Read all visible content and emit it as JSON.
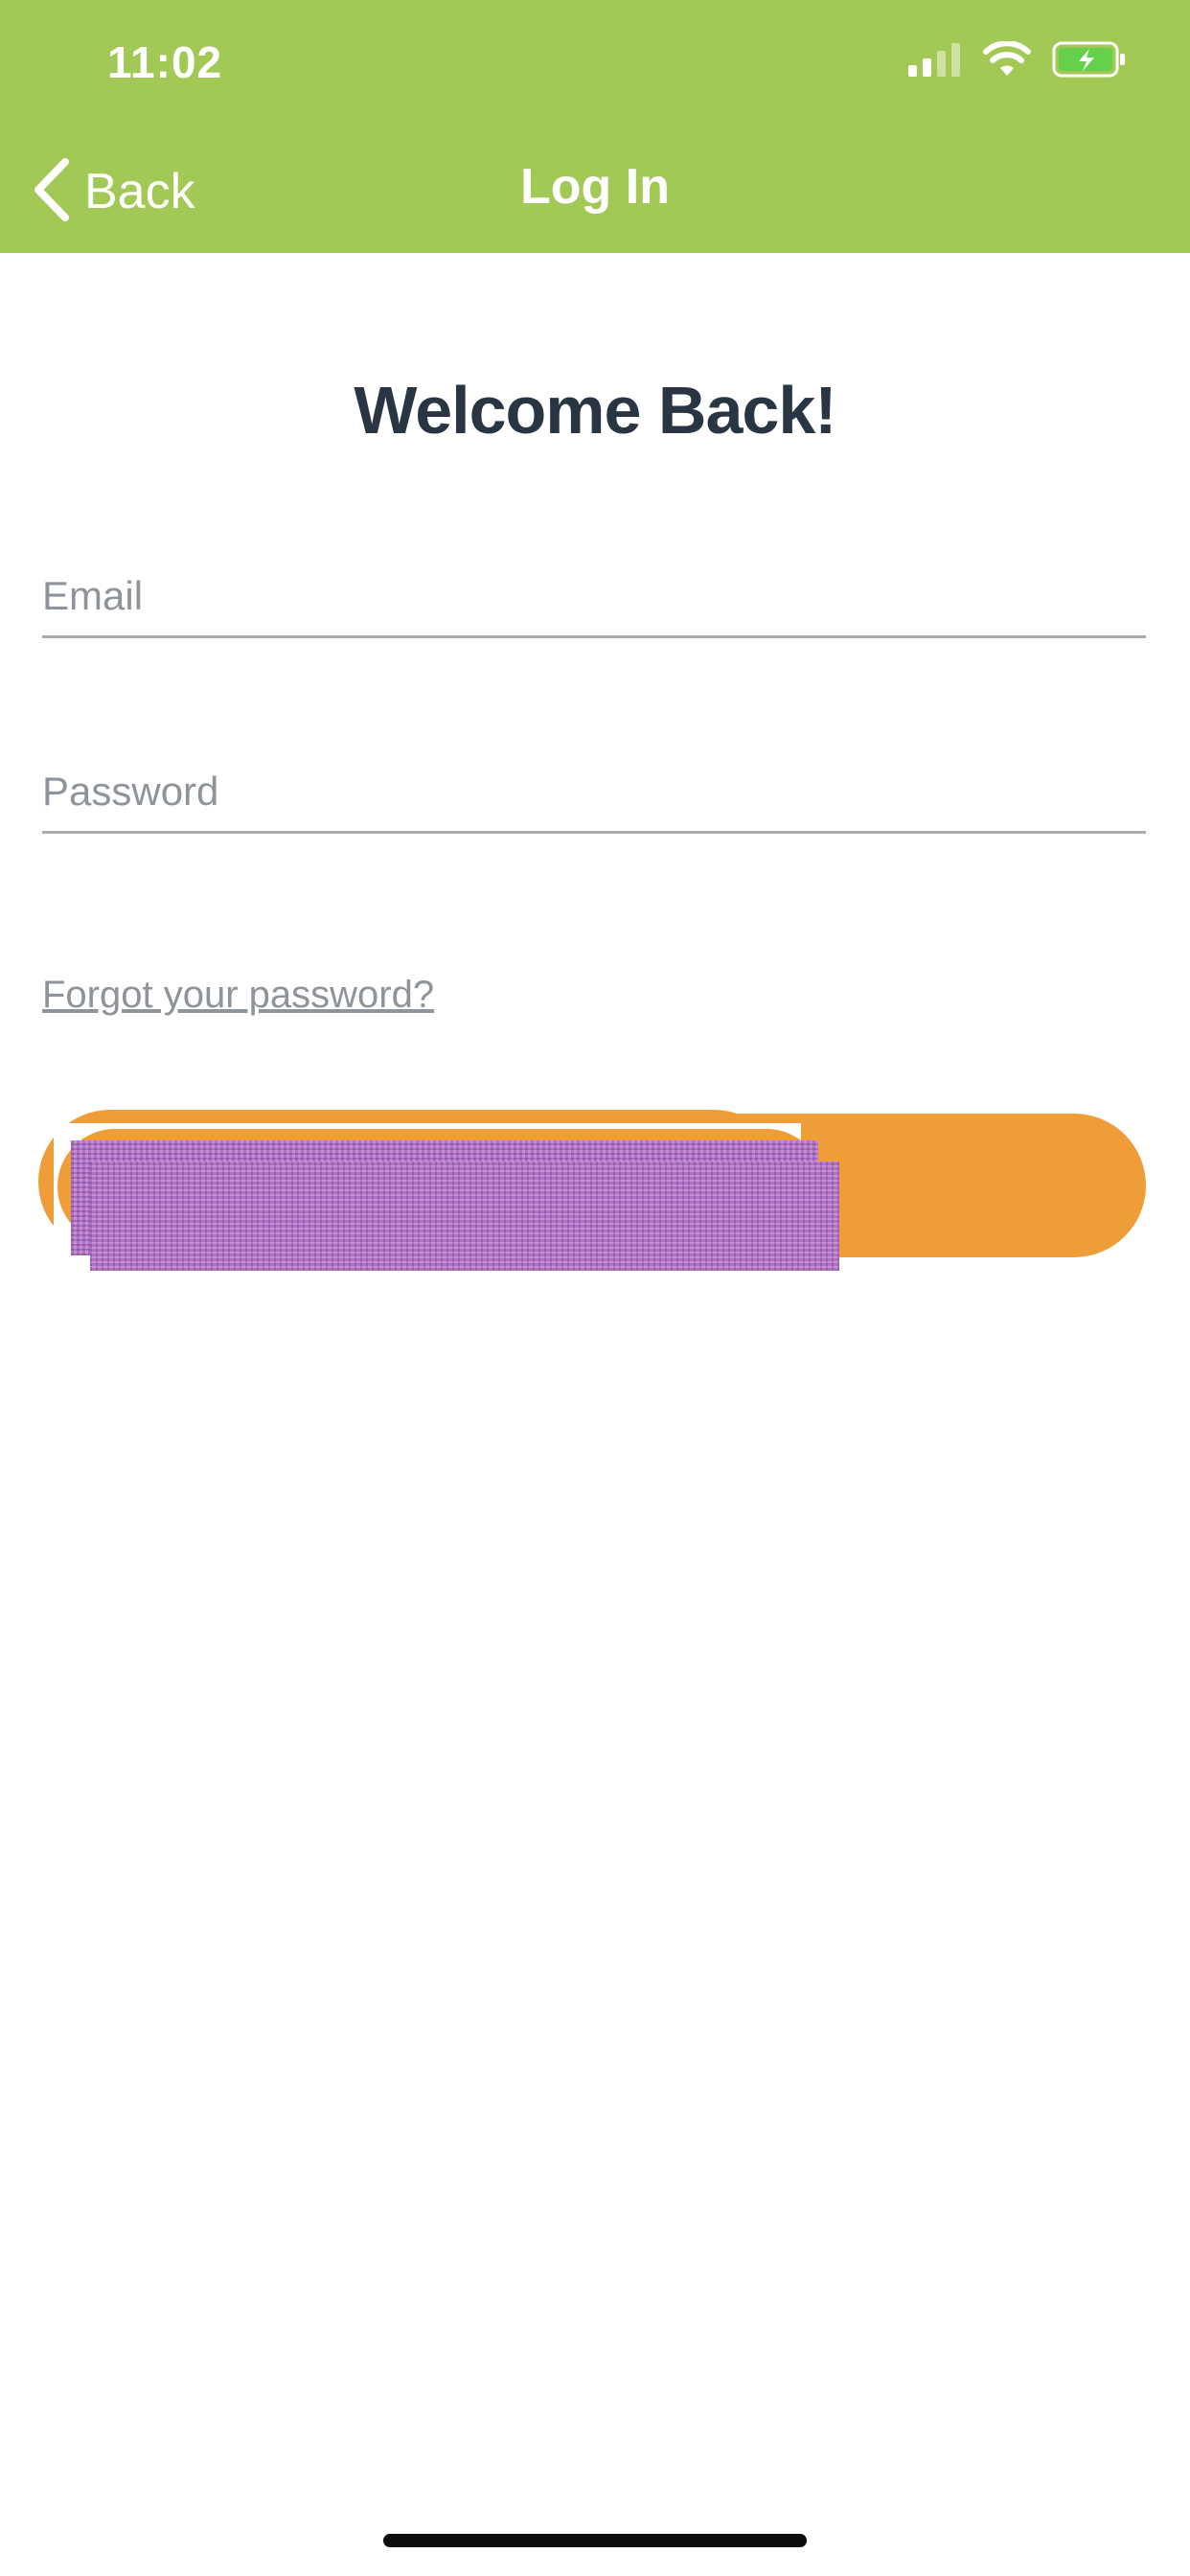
{
  "colors": {
    "header_bg": "#a2c856",
    "text_on_header": "#ffffff",
    "heading": "#2a3544",
    "placeholder": "#8f939a",
    "underline": "#a9abb0",
    "button_bg": "#ee9d38",
    "redaction": "#b77bc4",
    "battery_fill": "#65d14a"
  },
  "status_bar": {
    "time": "11:02",
    "icons": [
      "signal-icon",
      "wifi-icon",
      "battery-charging-icon"
    ]
  },
  "nav": {
    "back_label": "Back",
    "back_icon": "chevron-left-icon",
    "title": "Log In"
  },
  "form": {
    "heading": "Welcome Back!",
    "email": {
      "placeholder": "Email",
      "value": ""
    },
    "password": {
      "placeholder": "Password",
      "value": ""
    },
    "forgot_password_label": "Forgot your password?",
    "submit_label": ""
  }
}
